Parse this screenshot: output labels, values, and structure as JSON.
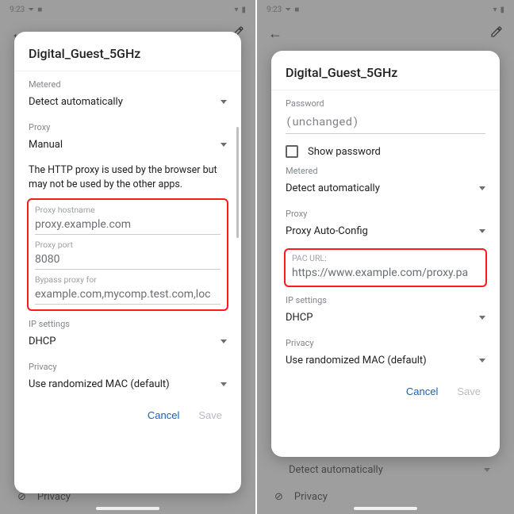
{
  "status": {
    "time": "9:23",
    "signal": "▲",
    "battery": "■"
  },
  "toolbar": {
    "back": "←",
    "edit": "✎"
  },
  "left": {
    "title": "Digital_Guest_5GHz",
    "metered_label": "Metered",
    "metered_value": "Detect automatically",
    "proxy_label": "Proxy",
    "proxy_value": "Manual",
    "help_text": "The HTTP proxy is used by the browser but may not be used by the other apps.",
    "hostname_label": "Proxy hostname",
    "hostname_value": "proxy.example.com",
    "port_label": "Proxy port",
    "port_value": "8080",
    "bypass_label": "Bypass proxy for",
    "bypass_value": "example.com,mycomp.test.com,loc",
    "ip_label": "IP settings",
    "ip_value": "DHCP",
    "privacy_label": "Privacy",
    "privacy_value": "Use randomized MAC (default)",
    "cancel": "Cancel",
    "save": "Save",
    "bg_privacy": "Privacy"
  },
  "right": {
    "title": "Digital_Guest_5GHz",
    "password_label": "Password",
    "password_value": "(unchanged)",
    "show_password": "Show password",
    "metered_label": "Metered",
    "metered_value": "Detect automatically",
    "proxy_label": "Proxy",
    "proxy_value": "Proxy Auto-Config",
    "pac_label": "PAC URL:",
    "pac_value": "https://www.example.com/proxy.pa",
    "ip_label": "IP settings",
    "ip_value": "DHCP",
    "privacy_label": "Privacy",
    "privacy_value": "Use randomized MAC (default)",
    "cancel": "Cancel",
    "save": "Save",
    "bg_detect": "Detect automatically",
    "bg_privacy": "Privacy"
  }
}
